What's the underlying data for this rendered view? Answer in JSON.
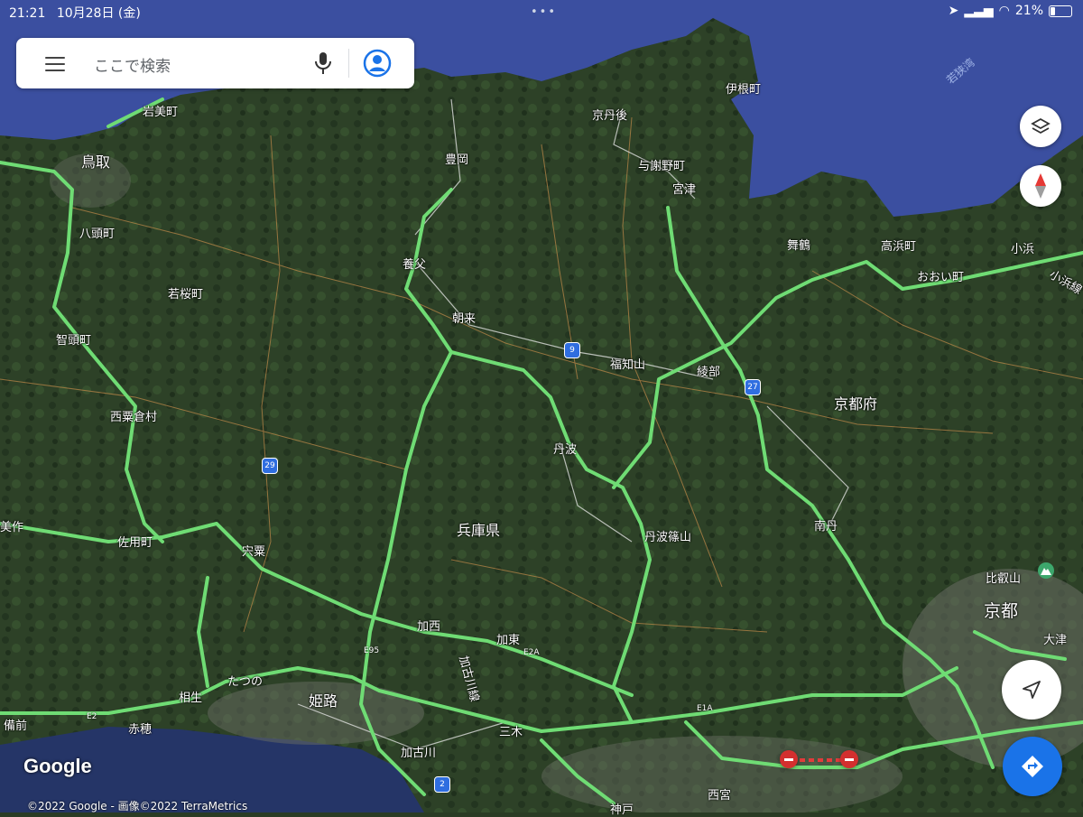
{
  "status_bar": {
    "time": "21:21",
    "date": "10月28日 (金)",
    "battery": "21%"
  },
  "search": {
    "placeholder": "ここで検索"
  },
  "cities": {
    "tottori": "鳥取",
    "iwami": "岩美町",
    "yazu": "八頭町",
    "wakasa": "若桜町",
    "chizu": "智頭町",
    "nishiawakura": "西粟倉村",
    "sayo": "佐用町",
    "mimasaka": "美作",
    "shiso": "宍粟",
    "tatsuno": "たつの",
    "aioi": "相生",
    "ako": "赤穂",
    "bizen": "備前",
    "himeji": "姫路",
    "kakogawa": "加古川",
    "kasai": "加西",
    "kato": "加東",
    "miki": "三木",
    "nishinomiya": "西宮",
    "kobe": "神戸",
    "toyooka": "豊岡",
    "yabu": "養父",
    "asago": "朝来",
    "kyotango": "京丹後",
    "yosano": "与謝野町",
    "miyazu": "宮津",
    "ine": "伊根町",
    "maizuru": "舞鶴",
    "takahama": "高浜町",
    "ohi": "おおい町",
    "obama": "小浜",
    "fukuchiyama": "福知山",
    "ayabe": "綾部",
    "tamba": "丹波",
    "tambasasayama": "丹波篠山",
    "nantan": "南丹",
    "kyoto": "京都",
    "otsu": "大津",
    "hieizan": "比叡山"
  },
  "regions": {
    "hyogo": "兵庫県",
    "kyoto_pref": "京都府",
    "wakasa_bay": "若狭湾"
  },
  "roads": {
    "r9": "9",
    "r27": "27",
    "r29": "29",
    "r2": "2",
    "e95": "E95",
    "e2a": "E2A",
    "e1a": "E1A",
    "e2": "E2",
    "obama_line": "小浜線",
    "kakogawa_river": "加古川線"
  },
  "attribution": {
    "logo": "Google",
    "copyright": "©2022 Google - 画像©2022 TerraMetrics"
  },
  "colors": {
    "traffic": "#6fdc74",
    "sea": "#3b4fa0",
    "terrain": "#2d4027"
  }
}
